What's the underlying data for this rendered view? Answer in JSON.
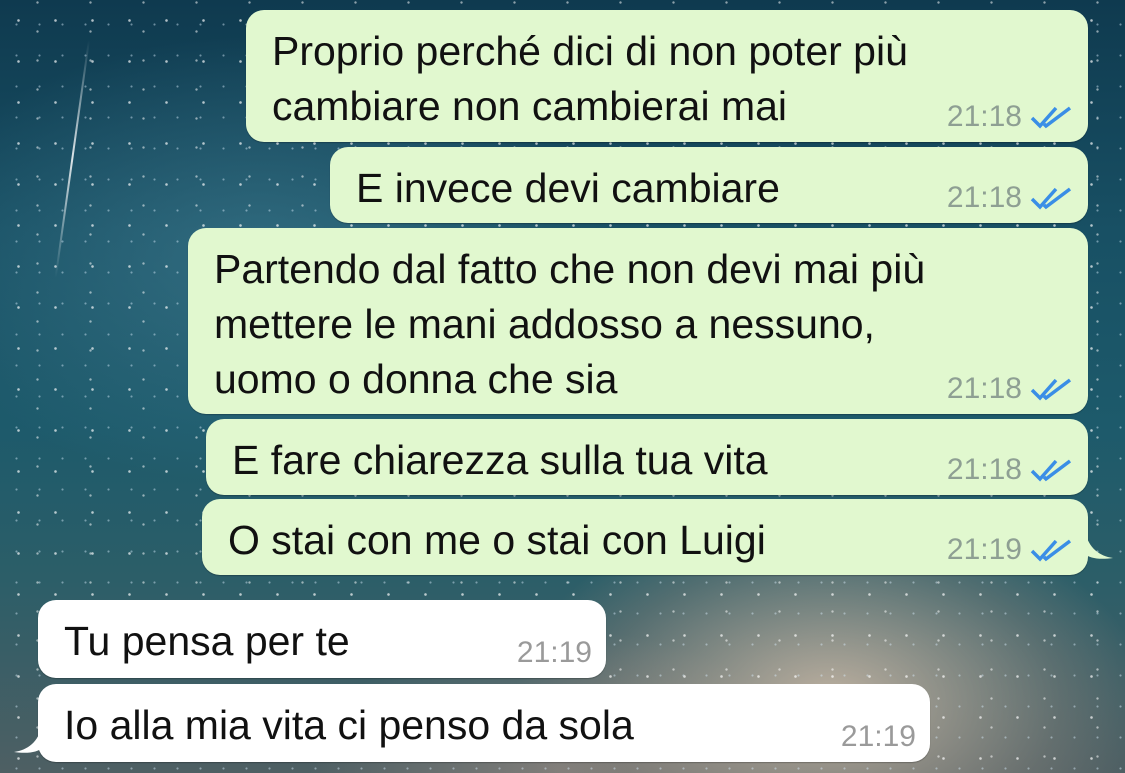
{
  "messages": [
    {
      "text": "Proprio perché dici di non poter più\ncambiare non cambierai mai",
      "time": "21:18",
      "status": "read-double-check"
    },
    {
      "text": "E invece devi cambiare",
      "time": "21:18",
      "status": "read-double-check"
    },
    {
      "text": "Partendo dal fatto che non devi mai più\nmettere le mani addosso a nessuno,\nuomo o donna che sia",
      "time": "21:18",
      "status": "read-double-check"
    },
    {
      "text": "E fare chiarezza sulla tua vita",
      "time": "21:18",
      "status": "read-double-check"
    },
    {
      "text": "O stai con me o stai con Luigi",
      "time": "21:19",
      "status": "read-double-check"
    },
    {
      "text": "Tu pensa per te",
      "time": "21:19"
    },
    {
      "text": "Io alla mia vita ci penso da sola",
      "time": "21:19"
    }
  ],
  "colors": {
    "outgoing_bubble": "#e1f8cf",
    "incoming_bubble": "#ffffff",
    "read_tick": "#3a8ee6",
    "timestamp": "#8e9f93"
  }
}
